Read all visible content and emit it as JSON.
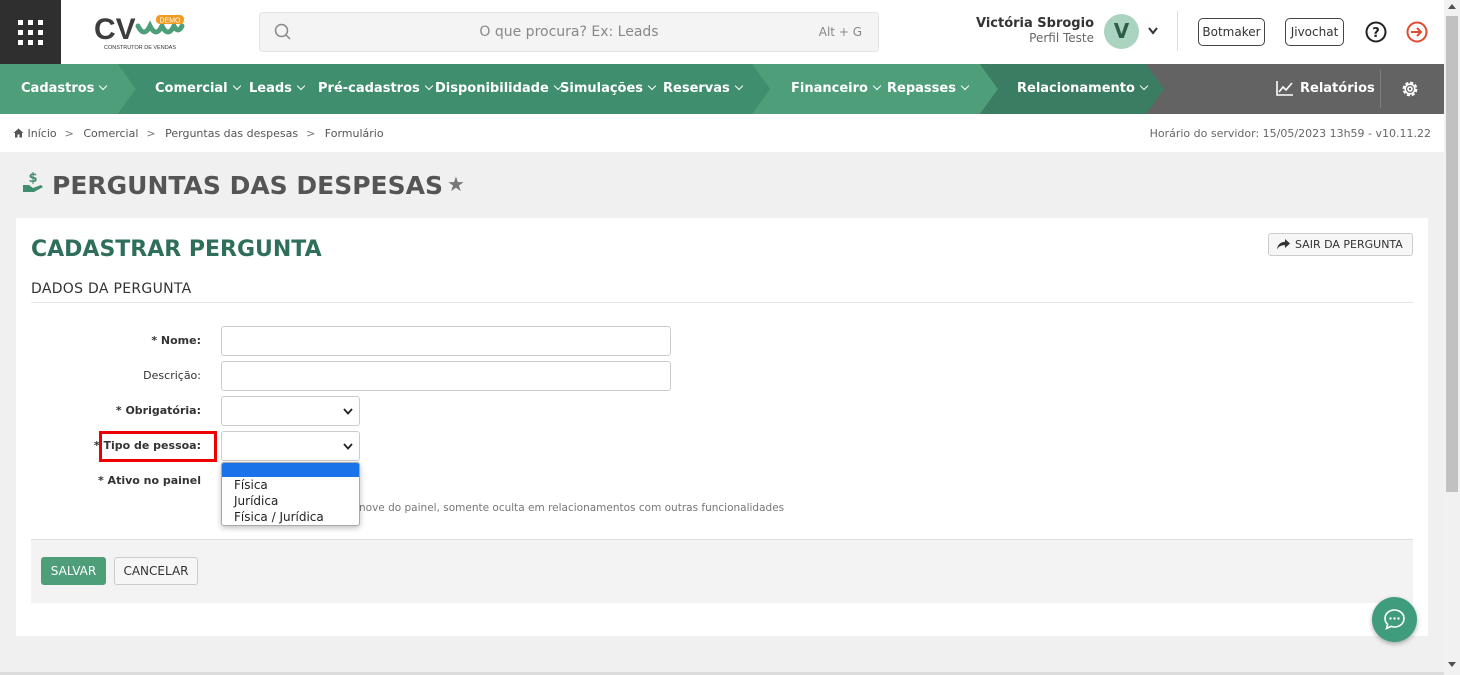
{
  "header": {
    "logo_text": "CV",
    "logo_tag": "DEMO",
    "logo_sub": "CONSTRUTOR DE VENDAS",
    "search_placeholder": "O que procura? Ex: Leads",
    "search_shortcut": "Alt + G",
    "user_name": "Victória Sbrogio",
    "user_profile": "Perfil Teste",
    "avatar_letter": "V",
    "botmaker_label": "Botmaker",
    "jivochat_label": "Jivochat"
  },
  "nav": {
    "groups": [
      {
        "color": "#4e9e7a"
      },
      {
        "color": "#3f8e6e"
      },
      {
        "color": "#4e9e7a"
      },
      {
        "color": "#3a7d62"
      }
    ],
    "items": [
      "Cadastros",
      "Comercial",
      "Leads",
      "Pré-cadastros",
      "Disponibilidade",
      "Simulações",
      "Reservas",
      "Financeiro",
      "Repasses",
      "Relacionamento"
    ],
    "reports_label": "Relatórios"
  },
  "breadcrumb": {
    "items": [
      "Início",
      "Comercial",
      "Perguntas das despesas",
      "Formulário"
    ],
    "server_time": "Horário do servidor: 15/05/2023 13h59 - v10.11.22"
  },
  "page": {
    "title": "PERGUNTAS DAS DESPESAS"
  },
  "form": {
    "title": "CADASTRAR PERGUNTA",
    "exit_label": "SAIR DA PERGUNTA",
    "section": "DADOS DA PERGUNTA",
    "fields": {
      "nome": {
        "label": "* Nome:",
        "value": ""
      },
      "descricao": {
        "label": "Descrição:",
        "value": ""
      },
      "obrigatoria": {
        "label": "* Obrigatória:",
        "value": ""
      },
      "tipo_pessoa": {
        "label": "* Tipo de pessoa:",
        "value": ""
      },
      "ativo": {
        "label": "* Ativo no painel"
      }
    },
    "ativo_hint": "nove do painel, somente oculta em relacionamentos com outras funcionalidades",
    "save_label": "SALVAR",
    "cancel_label": "CANCELAR"
  },
  "dropdown": {
    "options": [
      "",
      "Física",
      "Jurídica",
      "Física / Jurídica"
    ],
    "highlight_color": "#1a73e8"
  },
  "colors": {
    "accent": "#4e9e7a",
    "title_green": "#2f6e5a",
    "highlight_red": "#e00000"
  }
}
